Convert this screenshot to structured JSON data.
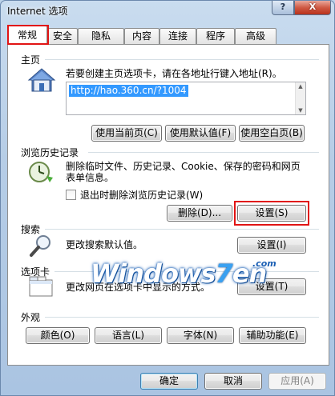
{
  "window": {
    "title": "Internet 选项",
    "help_glyph": "?",
    "close_glyph": "X"
  },
  "tabs": [
    {
      "label": "常规",
      "active": true
    },
    {
      "label": "安全"
    },
    {
      "label": "隐私"
    },
    {
      "label": "内容"
    },
    {
      "label": "连接"
    },
    {
      "label": "程序"
    },
    {
      "label": "高级"
    }
  ],
  "home": {
    "section": "主页",
    "description": "若要创建主页选项卡，请在各地址行键入地址(R)。",
    "address": "http://hao.360.cn/?1004",
    "btn_current": "使用当前页(C)",
    "btn_default": "使用默认值(F)",
    "btn_blank": "使用空白页(B)"
  },
  "history": {
    "section": "浏览历史记录",
    "description": "删除临时文件、历史记录、Cookie、保存的密码和网页表单信息。",
    "checkbox_label": "退出时删除浏览历史记录(W)",
    "checkbox_checked": false,
    "btn_delete": "删除(D)...",
    "btn_settings": "设置(S)"
  },
  "search": {
    "section": "搜索",
    "description": "更改搜索默认值。",
    "btn_settings": "设置(I)"
  },
  "tabs_section": {
    "section": "选项卡",
    "description": "更改网页在选项卡中显示的方式。",
    "btn_settings": "设置(T)"
  },
  "appearance": {
    "section": "外观",
    "btn_colors": "颜色(O)",
    "btn_languages": "语言(L)",
    "btn_fonts": "字体(N)",
    "btn_accessibility": "辅助功能(E)"
  },
  "watermark": {
    "text_pre": "Windows",
    "text_seven": "7",
    "text_post": "en",
    "suffix": ".com"
  },
  "footer": {
    "ok": "确定",
    "cancel": "取消",
    "apply": "应用(A)"
  },
  "colors": {
    "highlight_red": "#e11414",
    "selection_blue": "#3399ff"
  }
}
